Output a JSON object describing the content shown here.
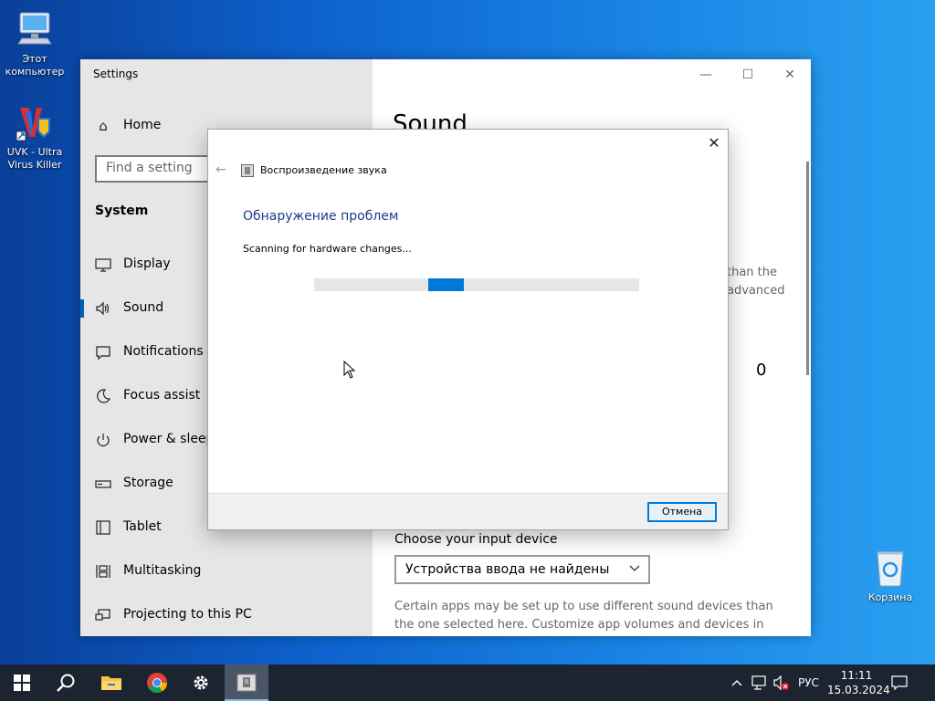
{
  "desktop": {
    "icons": [
      {
        "name": "this-pc",
        "label_line1": "Этот",
        "label_line2": "компьютер"
      },
      {
        "name": "uvk",
        "label_line1": "UVK - Ultra",
        "label_line2": "Virus Killer"
      },
      {
        "name": "recycle-bin",
        "label_line1": "Корзина",
        "label_line2": ""
      }
    ]
  },
  "settings": {
    "title": "Settings",
    "home_label": "Home",
    "search_placeholder": "Find a setting",
    "section_label": "System",
    "nav_items": [
      {
        "label": "Display",
        "icon": "monitor-icon"
      },
      {
        "label": "Sound",
        "icon": "speaker-icon"
      },
      {
        "label": "Notifications & actions",
        "icon": "notification-icon"
      },
      {
        "label": "Focus assist",
        "icon": "moon-icon"
      },
      {
        "label": "Power & sleep",
        "icon": "power-icon"
      },
      {
        "label": "Storage",
        "icon": "storage-icon"
      },
      {
        "label": "Tablet",
        "icon": "tablet-icon"
      },
      {
        "label": "Multitasking",
        "icon": "multitasking-icon"
      },
      {
        "label": "Projecting to this PC",
        "icon": "projecting-icon"
      }
    ],
    "active_item": "Sound",
    "main": {
      "heading": "Sound",
      "partial_text_1": "than the",
      "partial_text_2": "advanced",
      "partial_value": "0",
      "input_heading": "Choose your input device",
      "input_select_value": "Устройства ввода не найдены",
      "input_desc": "Certain apps may be set up to use different sound devices than the one selected here. Customize app volumes and devices in advanced"
    }
  },
  "dialog": {
    "header_title": "Воспроизведение звука",
    "heading": "Обнаружение проблем",
    "status_text": "Scanning for hardware changes...",
    "cancel_label": "Отмена"
  },
  "taskbar": {
    "lang": "РУС",
    "time": "11:11",
    "date": "15.03.2024"
  },
  "colors": {
    "accent": "#0078d7",
    "sidebar_bg": "#e6e6e6",
    "taskbar_bg": "#1c2431"
  }
}
